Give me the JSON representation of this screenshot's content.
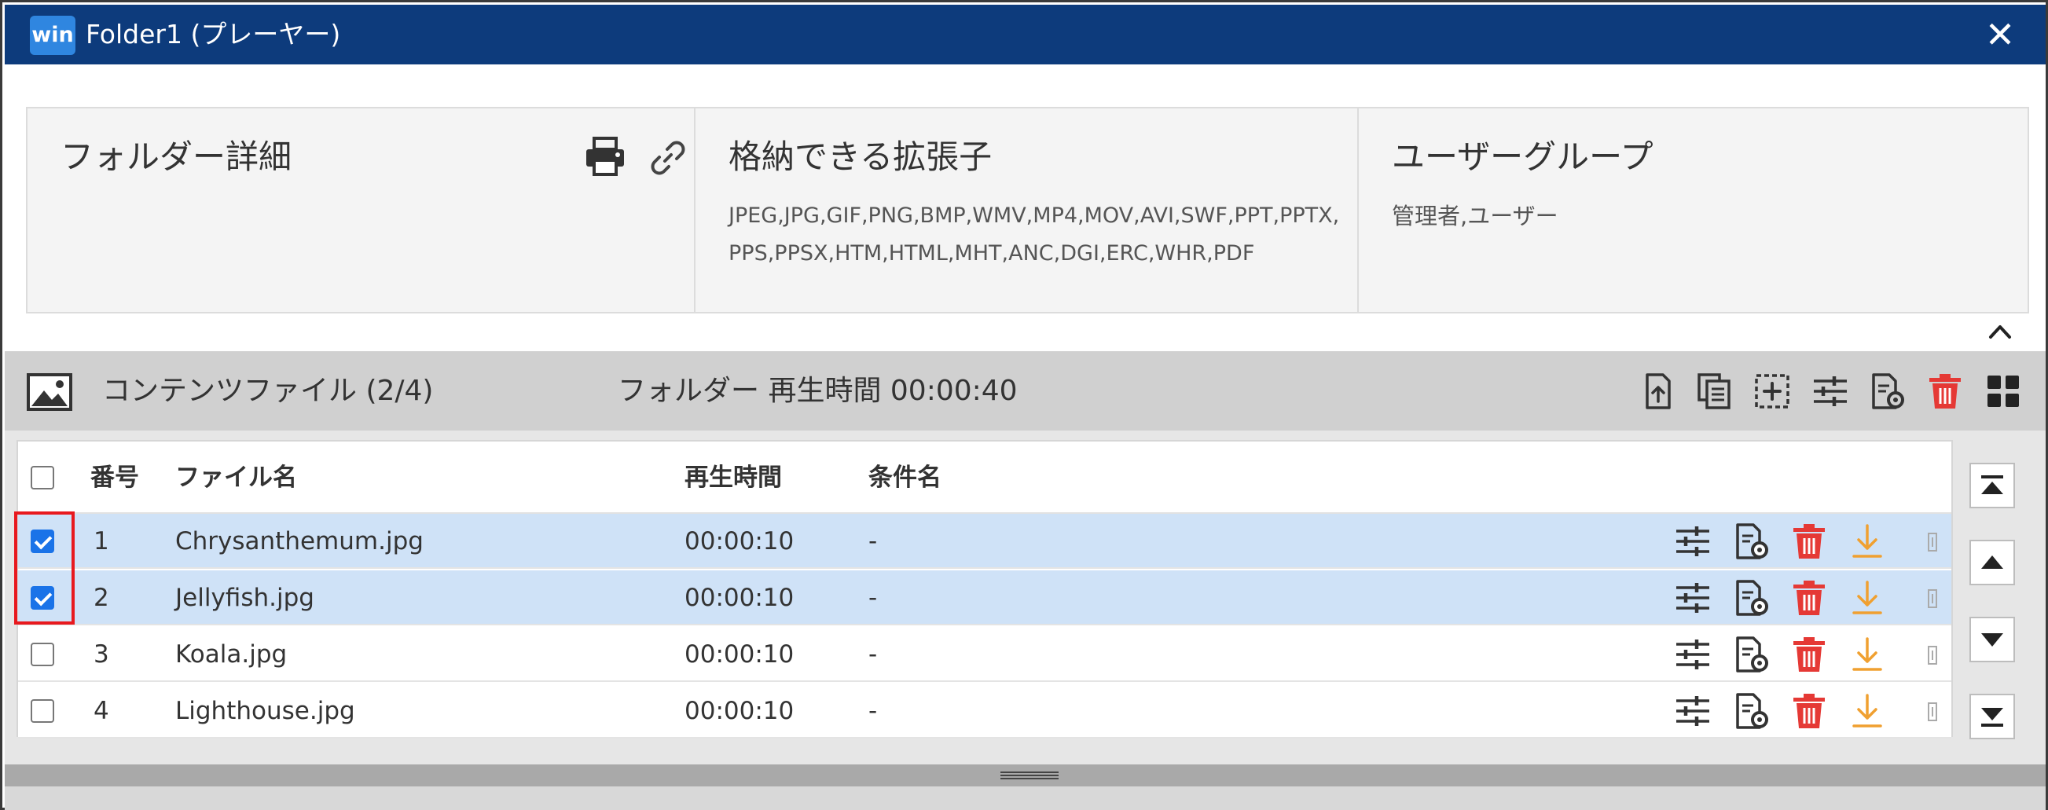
{
  "window": {
    "app_badge": "win",
    "title": "Folder1 (プレーヤー)",
    "close_label": "✕"
  },
  "details": {
    "folder_heading": "フォルダー詳細",
    "extensions_heading": "格納できる拡張子",
    "extensions_value": "JPEG,JPG,GIF,PNG,BMP,WMV,MP4,MOV,AVI,SWF,PPT,PPTX,PPS,PPSX,HTM,HTML,MHT,ANC,DGI,ERC,WHR,PDF",
    "usergroup_heading": "ユーザーグループ",
    "usergroup_value": "管理者,ユーザー"
  },
  "content": {
    "title": "コンテンツファイル (2/4)",
    "folder_duration": "フォルダー 再生時間 00:00:40"
  },
  "table": {
    "headers": {
      "number": "番号",
      "filename": "ファイル名",
      "duration": "再生時間",
      "condition": "条件名"
    },
    "rows": [
      {
        "checked": true,
        "number": "1",
        "filename": "Chrysanthemum.jpg",
        "duration": "00:00:10",
        "condition": "-"
      },
      {
        "checked": true,
        "number": "2",
        "filename": "Jellyfish.jpg",
        "duration": "00:00:10",
        "condition": "-"
      },
      {
        "checked": false,
        "number": "3",
        "filename": "Koala.jpg",
        "duration": "00:00:10",
        "condition": "-"
      },
      {
        "checked": false,
        "number": "4",
        "filename": "Lighthouse.jpg",
        "duration": "00:00:10",
        "condition": "-"
      }
    ]
  },
  "icons": {
    "toolbar": [
      "upload-file-icon",
      "copy-icon",
      "add-select-icon",
      "settings-sliders-icon",
      "file-settings-icon",
      "trash-icon",
      "grid-view-icon"
    ],
    "row": [
      "settings-sliders-icon",
      "file-settings-icon",
      "trash-icon",
      "download-icon",
      "drag-handle-icon"
    ],
    "move": [
      "move-top-icon",
      "move-up-icon",
      "move-down-icon",
      "move-bottom-icon"
    ]
  },
  "colors": {
    "titlebar": "#0d3b7c",
    "badge": "#2f86e0",
    "selected_row": "#cfe2f7",
    "checkbox": "#1a73e8",
    "trash": "#e53935",
    "download": "#f0a030",
    "highlight": "#e8191e"
  }
}
